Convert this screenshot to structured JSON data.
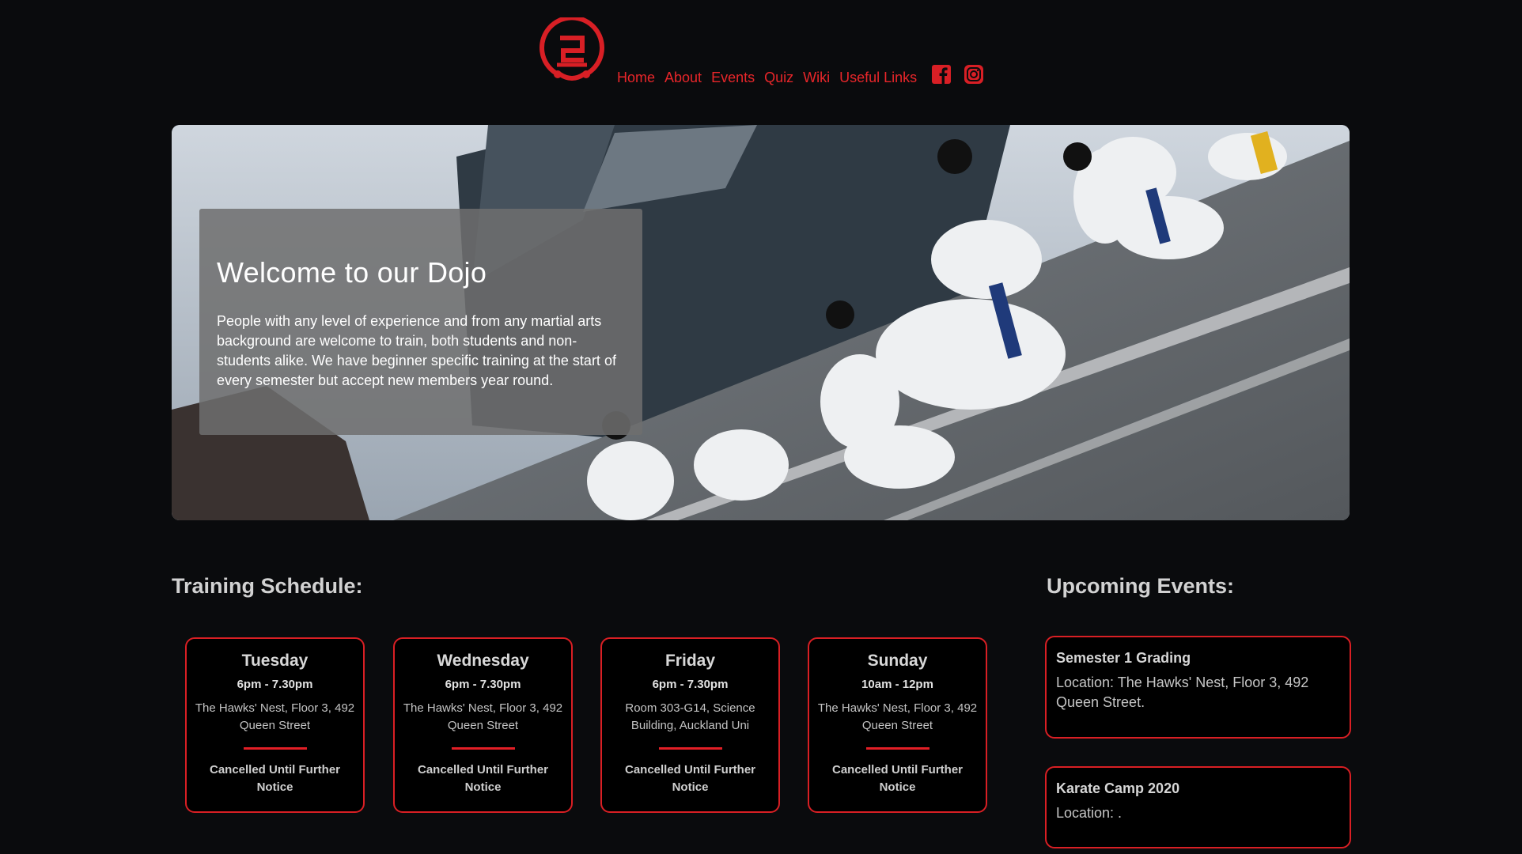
{
  "colors": {
    "accent": "#e8262a",
    "background": "#0a0b0d",
    "card_border": "#d91f24"
  },
  "header": {
    "logo_icon": "dojo-logo-icon",
    "nav": [
      "Home",
      "About",
      "Events",
      "Quiz",
      "Wiki",
      "Useful Links"
    ],
    "social": [
      "facebook-icon",
      "instagram-icon"
    ]
  },
  "hero": {
    "title": "Welcome to our Dojo",
    "text": "People with any level of experience and from any martial arts background are welcome to train, both students and non-students alike. We have beginner specific training at the start of every semester but accept new members year round."
  },
  "schedule": {
    "title": "Training Schedule:",
    "cards": [
      {
        "day": "Tuesday",
        "time": "6pm - 7.30pm",
        "location": "The Hawks' Nest, Floor 3, 492 Queen Street",
        "status": "Cancelled Until Further Notice"
      },
      {
        "day": "Wednesday",
        "time": "6pm - 7.30pm",
        "location": "The Hawks' Nest, Floor 3, 492 Queen Street",
        "status": "Cancelled Until Further Notice"
      },
      {
        "day": "Friday",
        "time": "6pm - 7.30pm",
        "location": "Room 303-G14, Science Building, Auckland Uni",
        "status": "Cancelled Until Further Notice"
      },
      {
        "day": "Sunday",
        "time": "10am - 12pm",
        "location": "The Hawks' Nest, Floor 3, 492 Queen Street",
        "status": "Cancelled Until Further Notice"
      }
    ]
  },
  "events": {
    "title": "Upcoming Events:",
    "items": [
      {
        "title": "Semester 1 Grading",
        "location": "Location: The Hawks' Nest, Floor 3, 492 Queen Street."
      },
      {
        "title": "Karate Camp 2020",
        "location": "Location: ."
      }
    ]
  }
}
